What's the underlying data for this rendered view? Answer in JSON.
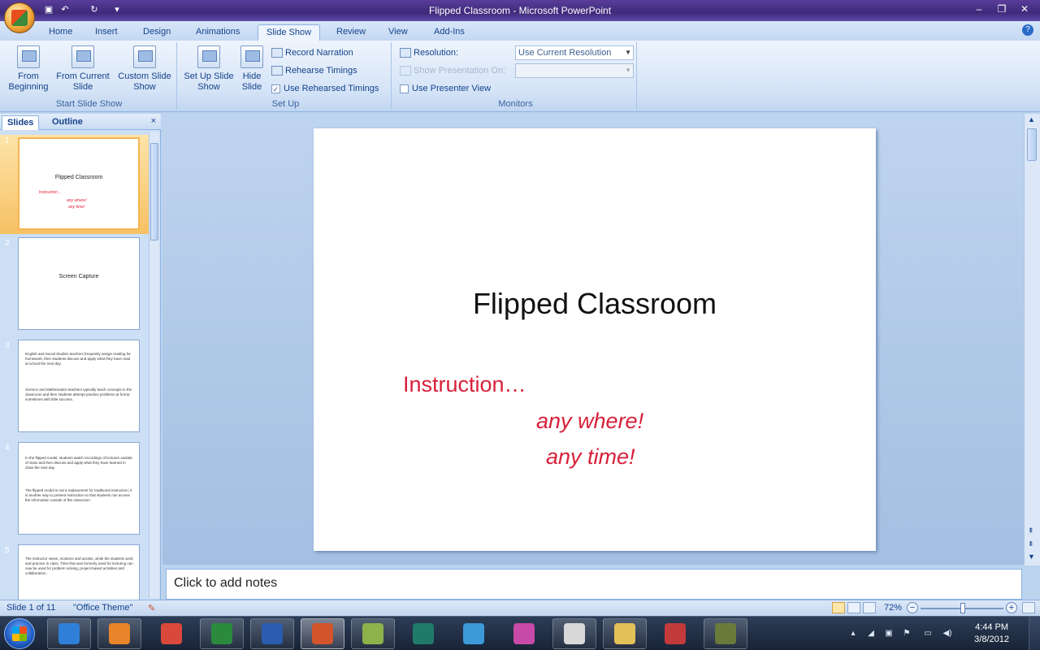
{
  "window": {
    "title": "Flipped Classroom - Microsoft PowerPoint",
    "controls": [
      "–",
      "❐",
      "✕"
    ]
  },
  "tabs": [
    {
      "label": "Home"
    },
    {
      "label": "Insert"
    },
    {
      "label": "Design"
    },
    {
      "label": "Animations"
    },
    {
      "label": "Slide Show",
      "active": true
    },
    {
      "label": "Review"
    },
    {
      "label": "View"
    },
    {
      "label": "Add-Ins"
    }
  ],
  "ribbon": {
    "start_group": {
      "label": "Start Slide Show",
      "from_beginning": "From Beginning",
      "from_current": "From Current Slide",
      "custom_show": "Custom Slide Show"
    },
    "setup_group": {
      "label": "Set Up",
      "setup_show": "Set Up Slide Show",
      "hide_slide": "Hide Slide",
      "record_narration": "Record Narration",
      "rehearse_timings": "Rehearse Timings",
      "use_rehearsed": "Use Rehearsed Timings"
    },
    "monitors_group": {
      "label": "Monitors",
      "resolution_label": "Resolution:",
      "resolution_value": "Use Current Resolution",
      "show_on_label": "Show Presentation On:",
      "show_on_value": "",
      "presenter_view": "Use Presenter View"
    }
  },
  "left_pane": {
    "tab_slides": "Slides",
    "tab_outline": "Outline",
    "close": "×",
    "thumbnails": [
      {
        "num": "1",
        "title": "Flipped Classroom",
        "l1": "Instruction...",
        "l2": "any where!",
        "l3": "any time!"
      },
      {
        "num": "2",
        "title": "Screen Capture"
      },
      {
        "num": "3",
        "p1": "English and Social Studies teachers frequently assign reading for homework, then students discuss and apply what they have read at school the next day.",
        "p2": "Science and Mathematics teachers typically teach concepts in the classroom and then students attempt practice problems at home; sometimes with little success."
      },
      {
        "num": "4",
        "p1": "In the flipped model, students watch recordings of lectures outside of class and then discuss and apply what they have learned in class the next day.",
        "p2": "The flipped model is not a replacement for traditional instruction; it is another way to present instruction so that students can access the information outside of the classroom."
      },
      {
        "num": "5",
        "p1": "The instructor views, monitors and assists, while the students work and practice in class. Time that was formerly used for lecturing can now be used for problem solving, project-based activities and collaboration."
      }
    ]
  },
  "slide": {
    "title": "Flipped Classroom",
    "line1": "Instruction…",
    "line2": "any where!",
    "line3": "any time!"
  },
  "notes": {
    "placeholder": "Click to add notes"
  },
  "status": {
    "slide_count": "Slide 1 of 11",
    "theme": "\"Office Theme\"",
    "zoom": "72%"
  },
  "taskbar": {
    "apps": [
      {
        "name": "internet-explorer",
        "color": "#2f7fd8"
      },
      {
        "name": "media-player",
        "color": "#e8842a"
      },
      {
        "name": "chrome",
        "color": "#d9493b"
      },
      {
        "name": "excel",
        "color": "#2b8a3e"
      },
      {
        "name": "word",
        "color": "#2a5db0"
      },
      {
        "name": "powerpoint",
        "color": "#d2542b"
      },
      {
        "name": "notes",
        "color": "#8db24a"
      },
      {
        "name": "camtasia",
        "color": "#1f7a6a"
      },
      {
        "name": "pencil",
        "color": "#3c9ad8"
      },
      {
        "name": "app-grid",
        "color": "#c84aa8"
      },
      {
        "name": "calculator",
        "color": "#d8d8d8"
      },
      {
        "name": "folder",
        "color": "#e4c058"
      },
      {
        "name": "gift",
        "color": "#c23a3a"
      },
      {
        "name": "capture",
        "color": "#6a7a3a"
      }
    ],
    "time": "4:44 PM",
    "date": "3/8/2012"
  }
}
